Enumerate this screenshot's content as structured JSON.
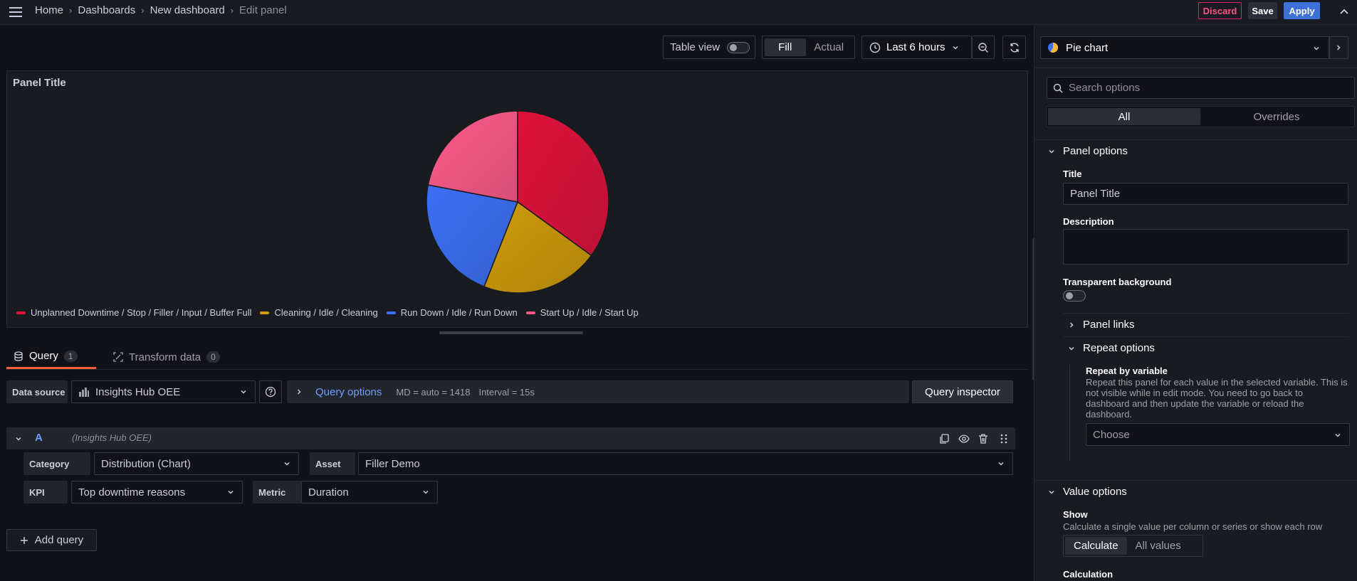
{
  "breadcrumb": {
    "items": [
      "Home",
      "Dashboards",
      "New dashboard"
    ],
    "current": "Edit panel"
  },
  "topbar": {
    "discard_label": "Discard",
    "save_label": "Save",
    "apply_label": "Apply"
  },
  "toolbar": {
    "table_view_label": "Table view",
    "table_view_on": false,
    "fill_label": "Fill",
    "actual_label": "Actual",
    "fill_active": true,
    "time_range": "Last 6 hours"
  },
  "panel": {
    "title": "Panel Title"
  },
  "chart_data": {
    "type": "pie",
    "title": "Panel Title",
    "legend_position": "bottom",
    "slices": [
      {
        "label": "Unplanned Downtime / Stop / Filler / Input / Buffer Full",
        "value": 35,
        "color": "#e0113a"
      },
      {
        "label": "Cleaning / Idle / Cleaning",
        "value": 21,
        "color": "#d09b09"
      },
      {
        "label": "Run Down / Idle / Run Down",
        "value": 22,
        "color": "#3b6ff5"
      },
      {
        "label": "Start Up / Idle / Start Up",
        "value": 22,
        "color": "#ff5a8a"
      }
    ]
  },
  "tabs": [
    {
      "label": "Query",
      "count": "1"
    },
    {
      "label": "Transform data",
      "count": "0"
    }
  ],
  "query_editor": {
    "data_source_label": "Data source",
    "data_source_value": "Insights Hub OEE",
    "query_options_label": "Query options",
    "md_info": "MD = auto = 1418",
    "interval_info": "Interval = 15s",
    "query_inspector_label": "Query inspector",
    "query": {
      "ref_id": "A",
      "datasource_name": "(Insights Hub OEE)",
      "category_label": "Category",
      "category_value": "Distribution (Chart)",
      "asset_label": "Asset",
      "asset_value": "Filler Demo",
      "kpi_label": "KPI",
      "kpi_value": "Top downtime reasons",
      "metric_label": "Metric",
      "metric_value": "Duration"
    },
    "add_query_label": "Add query"
  },
  "options_pane": {
    "visualization": "Pie chart",
    "search_placeholder": "Search options",
    "tab_all": "All",
    "tab_overrides": "Overrides",
    "panel_options": {
      "heading": "Panel options",
      "title_label": "Title",
      "title_value": "Panel Title",
      "description_label": "Description",
      "transparent_label": "Transparent background",
      "transparent_on": false,
      "panel_links_heading": "Panel links",
      "repeat_heading": "Repeat options",
      "repeat_by_label": "Repeat by variable",
      "repeat_desc_lines": [
        "Repeat this panel for each value in the selected variable. This is",
        "not visible while in edit mode. You need to go back to",
        "dashboard and then update the variable or reload the",
        "dashboard."
      ],
      "repeat_select_placeholder": "Choose"
    },
    "value_options": {
      "heading": "Value options",
      "show_label": "Show",
      "show_desc": "Calculate a single value per column or series or show each row",
      "calculate_label": "Calculate",
      "all_values_label": "All values",
      "calculate_active": true,
      "calculation_label": "Calculation"
    }
  }
}
